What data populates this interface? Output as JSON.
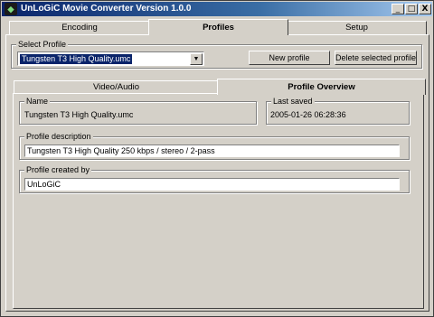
{
  "window": {
    "title": "UnLoGiC Movie Converter Version 1.0.0",
    "icon_name": "app-icon",
    "controls": [
      "_",
      "□",
      "X"
    ]
  },
  "main_tabs": [
    {
      "label": "Encoding",
      "active": false
    },
    {
      "label": "Profiles",
      "active": true
    },
    {
      "label": "Setup",
      "active": false
    }
  ],
  "select_profile": {
    "group_label": "Select Profile",
    "selected": "Tungsten T3 High Quality.umc",
    "new_button": "New profile",
    "delete_button": "Delete selected profile"
  },
  "sub_tabs": [
    {
      "label": "Video/Audio",
      "active": false
    },
    {
      "label": "Profile Overview",
      "active": true
    }
  ],
  "overview": {
    "name_label": "Name",
    "name_value": "Tungsten T3 High Quality.umc",
    "last_saved_label": "Last saved",
    "last_saved_value": "2005-01-26 06:28:36",
    "description_label": "Profile description",
    "description_value": "Tungsten T3 High Quality 250 kbps / stereo / 2-pass",
    "created_by_label": "Profile created by",
    "created_by_value": "UnLoGiC"
  }
}
